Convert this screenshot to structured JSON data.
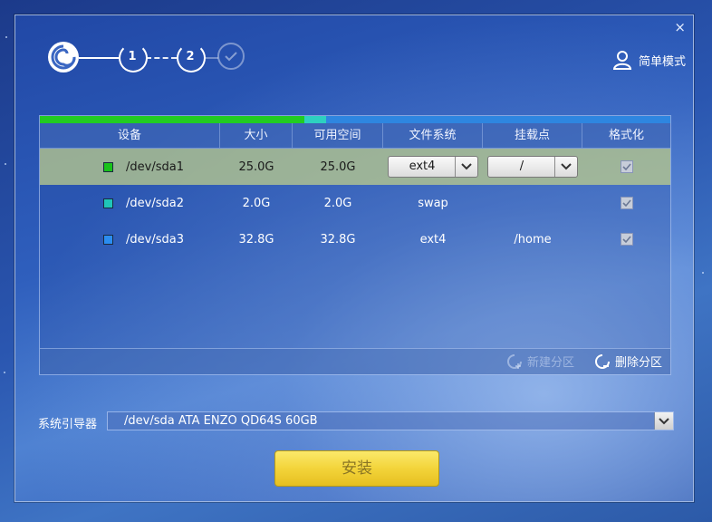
{
  "window": {
    "close_symbol": "×"
  },
  "steps": {
    "step1": "1",
    "step2": "2"
  },
  "header": {
    "simple_mode_label": "简单模式"
  },
  "table": {
    "columns": [
      "设备",
      "大小",
      "可用空间",
      "文件系统",
      "挂载点",
      "格式化"
    ],
    "rows": [
      {
        "device": "/dev/sda1",
        "size": "25.0G",
        "free": "25.0G",
        "fs": "ext4",
        "mount": "/",
        "format": true,
        "color": "#19c21a"
      },
      {
        "device": "/dev/sda2",
        "size": "2.0G",
        "free": "2.0G",
        "fs": "swap",
        "mount": "",
        "format": true,
        "color": "#20c5b8"
      },
      {
        "device": "/dev/sda3",
        "size": "32.8G",
        "free": "32.8G",
        "fs": "ext4",
        "mount": "/home",
        "format": true,
        "color": "#2b8df0"
      }
    ],
    "usage_colors": {
      "sda1": "#22cc22",
      "sda2": "#2dd0c0",
      "sda3": "#2e86e0"
    }
  },
  "actions": {
    "new_partition": "新建分区",
    "delete_partition": "删除分区"
  },
  "bootloader": {
    "label": "系统引导器",
    "value": "/dev/sda ATA ENZO QD64S 60GB"
  },
  "install_label": "安装"
}
